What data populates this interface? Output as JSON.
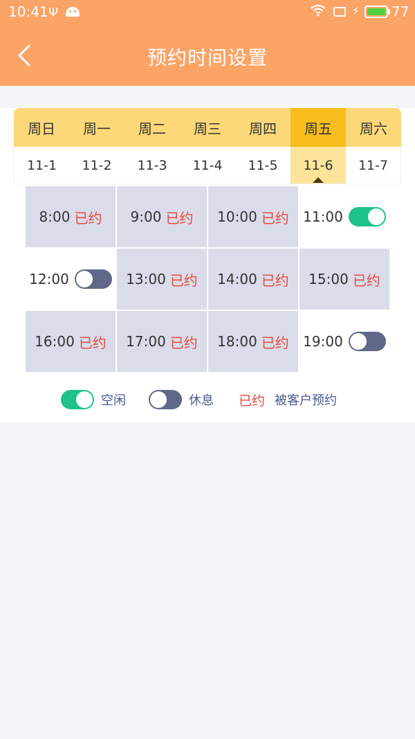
{
  "status": {
    "time": "10:41",
    "battery": "77"
  },
  "header": {
    "title": "预约时间设置",
    "back_icon": "chevron-left-icon"
  },
  "colors": {
    "header_bg": "#fca366",
    "weekday_bg": "#fcd878",
    "weekday_selected_bg": "#f7be1b",
    "date_selected_bg": "#fce49a",
    "booked_bg": "#dadcea",
    "booked_text": "#e84a3e",
    "toggle_on": "#1ec28b",
    "toggle_off": "#5f6888"
  },
  "week": {
    "selected_index": 5,
    "days": [
      {
        "name": "周日",
        "date": "11-1"
      },
      {
        "name": "周一",
        "date": "11-2"
      },
      {
        "name": "周二",
        "date": "11-3"
      },
      {
        "name": "周三",
        "date": "11-4"
      },
      {
        "name": "周四",
        "date": "11-5"
      },
      {
        "name": "周五",
        "date": "11-6"
      },
      {
        "name": "周六",
        "date": "11-7"
      }
    ]
  },
  "slots": [
    {
      "time": "8:00",
      "state": "booked",
      "label": "已约"
    },
    {
      "time": "9:00",
      "state": "booked",
      "label": "已约"
    },
    {
      "time": "10:00",
      "state": "booked",
      "label": "已约"
    },
    {
      "time": "11:00",
      "state": "free"
    },
    {
      "time": "12:00",
      "state": "rest"
    },
    {
      "time": "13:00",
      "state": "booked",
      "label": "已约"
    },
    {
      "time": "14:00",
      "state": "booked",
      "label": "已约"
    },
    {
      "time": "15:00",
      "state": "booked",
      "label": "已约"
    },
    {
      "time": "16:00",
      "state": "booked",
      "label": "已约"
    },
    {
      "time": "17:00",
      "state": "booked",
      "label": "已约"
    },
    {
      "time": "18:00",
      "state": "booked",
      "label": "已约"
    },
    {
      "time": "19:00",
      "state": "rest"
    }
  ],
  "legend": {
    "free_label": "空闲",
    "rest_label": "休息",
    "booked_label": "已约",
    "booked_desc": "被客户预约"
  }
}
